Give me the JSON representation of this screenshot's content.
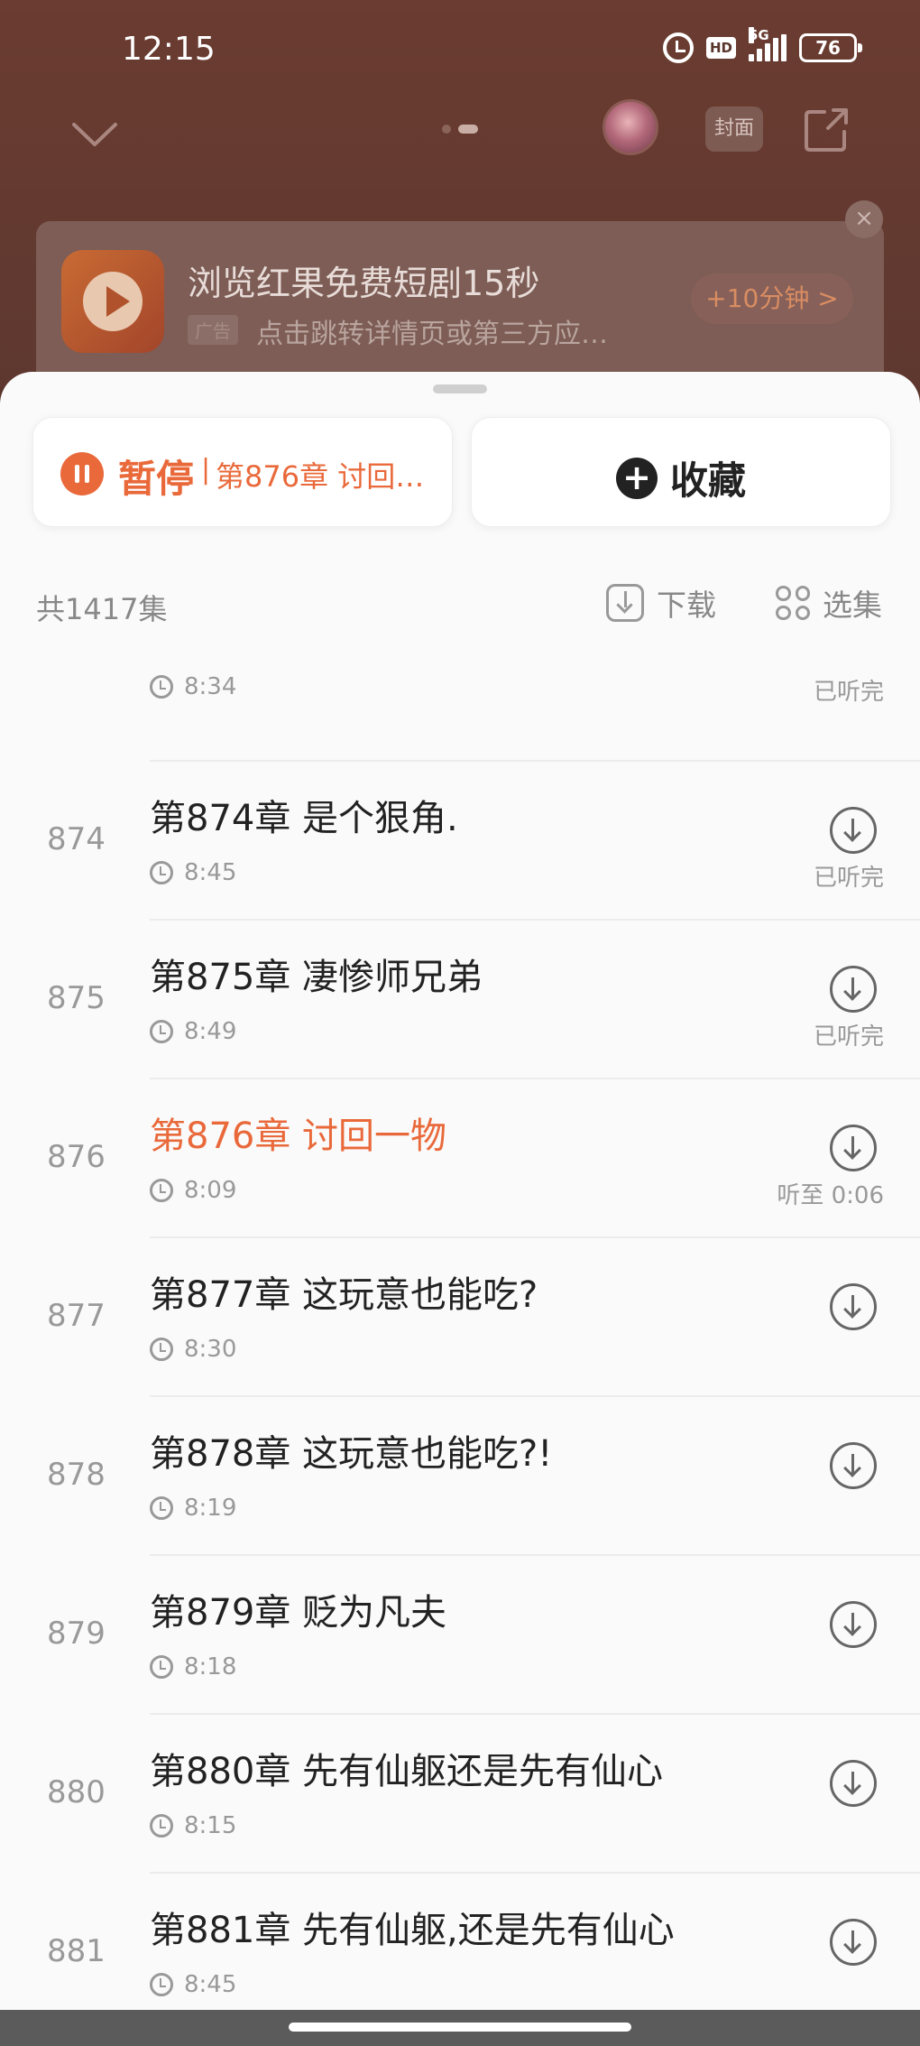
{
  "status_bar": {
    "time": "12:15",
    "hd": "HD",
    "network": "5G",
    "battery": "76"
  },
  "top_nav": {
    "cover_label": "封面"
  },
  "ad": {
    "title": "浏览红果免费短剧15秒",
    "tag": "广告",
    "description": "点击跳转详情页或第三方应…",
    "reward": "+10分钟 >",
    "close": "×"
  },
  "actions": {
    "pause_label": "暂停",
    "pause_sep": "|",
    "current_chapter": "第876章 讨回…",
    "favorite_label": "收藏",
    "favorite_plus": "+"
  },
  "list_header": {
    "total": "共1417集",
    "download": "下载",
    "select": "选集"
  },
  "episodes": [
    {
      "num": "",
      "title": "",
      "duration": "8:34",
      "status": "已听完"
    },
    {
      "num": "874",
      "title": "第874章 是个狠角.",
      "duration": "8:45",
      "status": "已听完"
    },
    {
      "num": "875",
      "title": "第875章 凄惨师兄弟",
      "duration": "8:49",
      "status": "已听完"
    },
    {
      "num": "876",
      "title": "第876章 讨回一物",
      "duration": "8:09",
      "status": "听至 0:06"
    },
    {
      "num": "877",
      "title": "第877章 这玩意也能吃?",
      "duration": "8:30",
      "status": ""
    },
    {
      "num": "878",
      "title": "第878章 这玩意也能吃?!",
      "duration": "8:19",
      "status": ""
    },
    {
      "num": "879",
      "title": "第879章 贬为凡夫",
      "duration": "8:18",
      "status": ""
    },
    {
      "num": "880",
      "title": "第880章 先有仙躯还是先有仙心",
      "duration": "8:15",
      "status": ""
    },
    {
      "num": "881",
      "title": "第881章 先有仙躯,还是先有仙心",
      "duration": "8:45",
      "status": ""
    }
  ],
  "colors": {
    "accent": "#e9693a",
    "text": "#222222",
    "muted": "#999999"
  }
}
